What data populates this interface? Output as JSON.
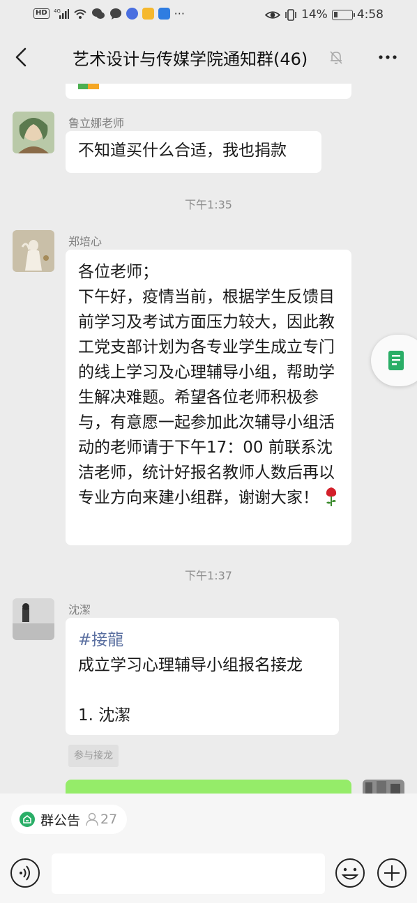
{
  "status_bar": {
    "network_hd": "HD",
    "network_gen": "4G",
    "battery_percent": "14%",
    "time": "4:58",
    "overflow_dots": "···"
  },
  "header": {
    "title": "艺术设计与传媒学院通知群(46)",
    "more_label": "···"
  },
  "messages": [
    {
      "sender": "鲁立娜老师",
      "text": "不知道买什么合适，我也捐款"
    },
    {
      "timestamp": "下午1:35",
      "sender": "郑培心",
      "text": "各位老师；\n下午好，疫情当前，根据学生反馈目前学习及考试方面压力较大，因此教工党支部计划为各专业学生成立专门的线上学习及心理辅导小组，帮助学生解决难题。希望各位老师积极参与，有意愿一起参加此次辅导小组活动的老师请于下午17：00 前联系沈洁老师，统计好报名教师人数后再以专业方向来建小组群，谢谢大家！"
    },
    {
      "timestamp": "下午1:37",
      "sender": "沈潔",
      "hashtag": "#接龍",
      "line1": "成立学习心理辅导小组报名接龙",
      "line2": "1. 沈潔",
      "join_button": "参与接龙"
    }
  ],
  "bottom": {
    "notice_label": "群公告",
    "notice_count": "27"
  },
  "colors": {
    "accent_green": "#95ec69",
    "notice_green": "#2aae67",
    "background": "#ececec",
    "bubble": "#ffffff"
  },
  "icons": {
    "back": "chevron-left-icon",
    "mute": "bell-off-icon",
    "more": "more-dots-icon",
    "float": "document-icon",
    "voice": "voice-icon",
    "emoji": "emoji-icon",
    "plus": "plus-icon",
    "notice": "announcement-icon",
    "people": "person-icon"
  }
}
